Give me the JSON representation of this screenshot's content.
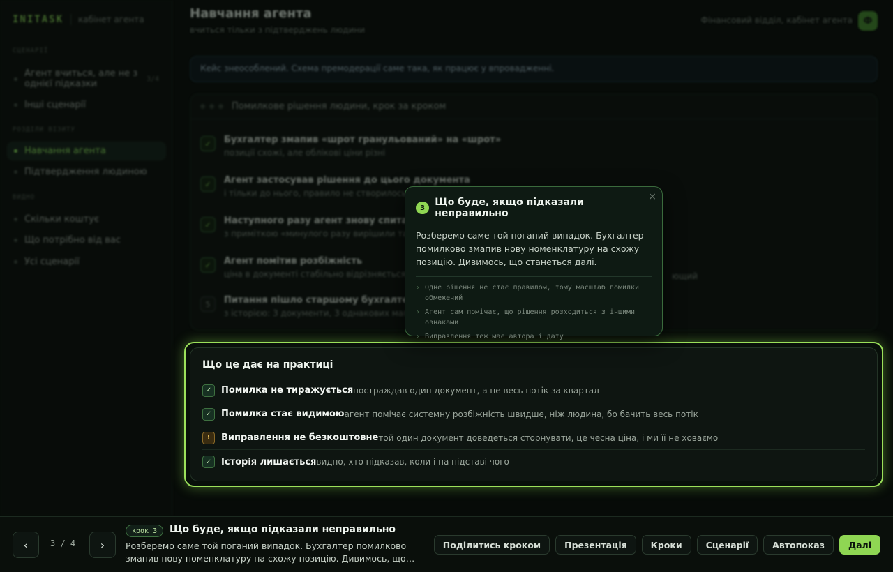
{
  "sidebar": {
    "brand": "INITASK",
    "brand_sub": "кабінет агента",
    "sections": [
      {
        "label": "СЦЕНАРІЇ"
      },
      {
        "label": "РОЗДІЛИ ВІЗИТУ"
      },
      {
        "label": "ВИДНО"
      }
    ],
    "items": [
      {
        "label": "Агент вчиться, але не з однієї підказки",
        "count": "3/4"
      },
      {
        "label": "Інші сценарії"
      },
      {
        "label": "Навчання агента"
      },
      {
        "label": "Підтвердження людиною"
      },
      {
        "label": "Скільки коштує"
      },
      {
        "label": "Що потрібно від вас"
      },
      {
        "label": "Усі сценарії"
      }
    ]
  },
  "header": {
    "title": "Навчання агента",
    "subtitle": "вчиться тільки з підтверджень людини",
    "org": "Фінансовий відділ, кабінет агента",
    "avatar": "Ф"
  },
  "notice": "Кейс знеособлений. Схема премодерації саме така, як працює у впровадженні.",
  "flow": {
    "title": "Помилкове рішення людини, крок за кроком",
    "steps": [
      {
        "badge": "✓",
        "title": "Бухгалтер змапив «шрот гранульований» на «шрот»",
        "desc": "позиції схожі, але облікові ціни різні"
      },
      {
        "badge": "✓",
        "title": "Агент застосував рішення до цього документа",
        "desc": "і тільки до нього, правило не створилось"
      },
      {
        "badge": "✓",
        "title": "Наступного разу агент знову спитав",
        "desc": "з приміткою «минулого разу вирішили так»"
      },
      {
        "badge": "✓",
        "title": "Агент помітив розбіжність",
        "desc": "ціна в документі стабільно відрізняється від"
      },
      {
        "badge": "5",
        "title": "Питання пішло старшому бухгалтеру",
        "desc": "з історією: 3 документи, 3 однакових мапінги"
      }
    ],
    "extra": "ющий"
  },
  "popover": {
    "num": "3",
    "title": "Що буде, якщо підказали неправильно",
    "body": "Розберемо саме той поганий випадок. Бухгалтер помилково змапив нову номенклатуру на схожу позицію. Дивимось, що станеться далі.",
    "bullets": [
      "Одне рішення не стає правилом, тому масштаб помилки обмежений",
      "Агент сам помічає, що рішення розходиться з іншими ознаками",
      "Виправлення теж має автора і дату"
    ],
    "close": "×"
  },
  "practice": {
    "title": "Що це дає на практиці",
    "rows": [
      {
        "icon": "✓",
        "head": "Помилка не тиражується",
        "text": "постраждав один документ, а не весь потік за квартал"
      },
      {
        "icon": "✓",
        "head": "Помилка стає видимою",
        "text": "агент помічає системну розбіжність швидше, ніж людина, бо бачить весь потік"
      },
      {
        "icon": "!",
        "head": "Виправлення не безкоштовне",
        "text": "той один документ доведеться сторнувати, це чесна ціна, і ми її не ховаємо"
      },
      {
        "icon": "✓",
        "head": "Історія лишається",
        "text": "видно, хто підказав, коли і на підставі чого"
      }
    ]
  },
  "bottombar": {
    "prev": "‹",
    "next": "›",
    "counter": "3 / 4",
    "step_pill": "крок 3",
    "title": "Що буде, якщо підказали неправильно",
    "desc": "Розберемо саме той поганий випадок. Бухгалтер помилково змапив нову номенклатуру на схожу позицію. Дивимось, що…",
    "actions": [
      "Поділитись кроком",
      "Презентація",
      "Кроки",
      "Сценарії",
      "Автопоказ"
    ],
    "primary": "Далі"
  },
  "colors": {
    "accent": "#8fd653",
    "warn": "#f0c860",
    "background": "#070b08"
  }
}
